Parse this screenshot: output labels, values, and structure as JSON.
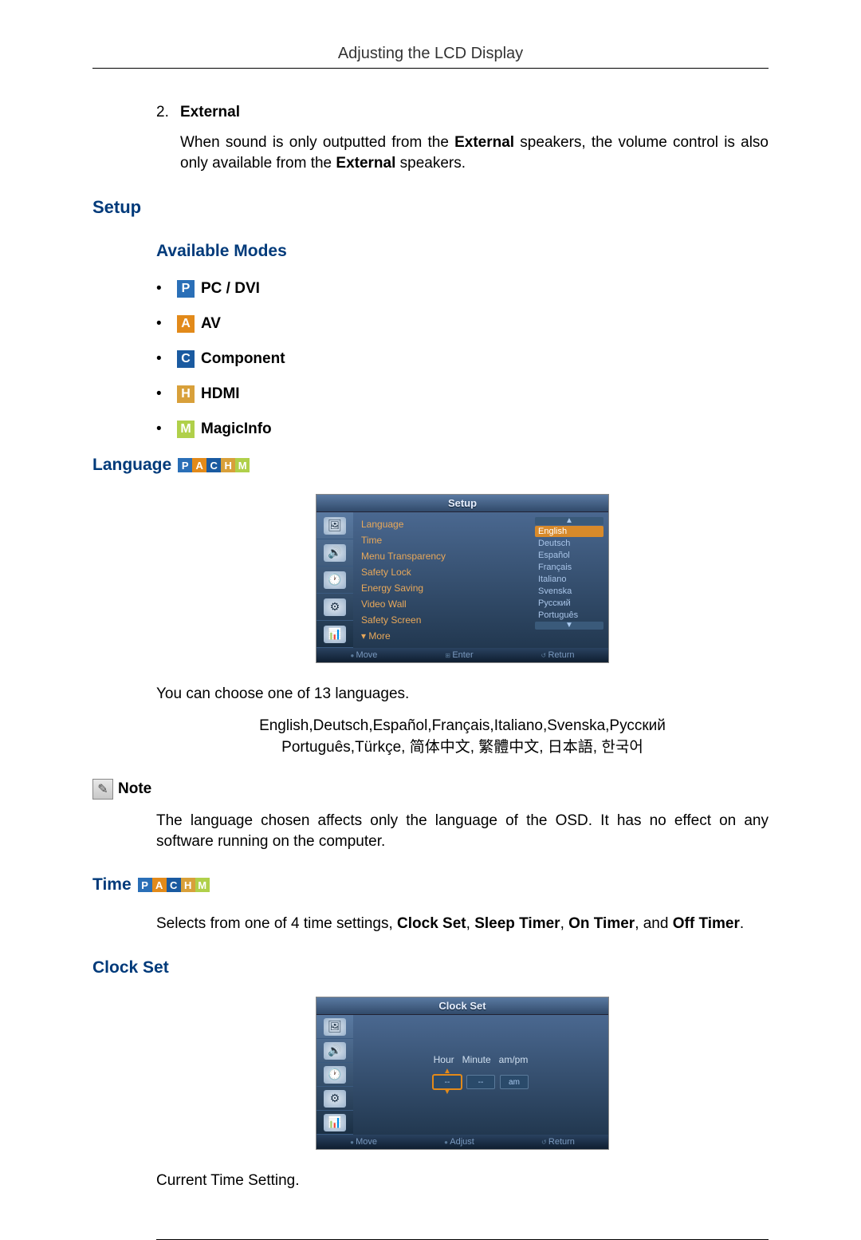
{
  "header": {
    "title": "Adjusting the LCD Display"
  },
  "external": {
    "number": "2.",
    "label": "External",
    "text_before": "When sound is only outputted from the ",
    "bold1": "External",
    "text_mid": " speakers, the volume control is also only available from the ",
    "bold2": "External",
    "text_after": " speakers."
  },
  "setup": {
    "heading": "Setup",
    "modes_heading": "Available Modes",
    "modes": [
      {
        "letter": "P",
        "cls": "badge-P",
        "label": "PC / DVI"
      },
      {
        "letter": "A",
        "cls": "badge-A",
        "label": "AV"
      },
      {
        "letter": "C",
        "cls": "badge-C",
        "label": "Component"
      },
      {
        "letter": "H",
        "cls": "badge-H",
        "label": "HDMI"
      },
      {
        "letter": "M",
        "cls": "badge-M",
        "label": "MagicInfo"
      }
    ]
  },
  "language": {
    "heading": "Language",
    "osd_title": "Setup",
    "menu_items": [
      "Language",
      "Time",
      "Menu Transparency",
      "Safety Lock",
      "Energy Saving",
      "Video Wall",
      "Safety Screen"
    ],
    "more": "▾ More",
    "options": [
      "English",
      "Deutsch",
      "Español",
      "Français",
      "Italiano",
      "Svenska",
      "Русский",
      "Português"
    ],
    "footer": {
      "move": "Move",
      "enter": "Enter",
      "return": "Return"
    },
    "caption": "You can choose one of 13 languages.",
    "langs_line1": "English,Deutsch,Español,Français,Italiano,Svenska,Русский",
    "langs_line2": "Português,Türkçe, 简体中文,  繁體中文, 日本語, 한국어",
    "note_label": "Note",
    "note_text": "The language chosen affects only the language of the OSD. It has no effect on any software running on the computer."
  },
  "time": {
    "heading": "Time",
    "text_before": "Selects from one of 4 time settings, ",
    "b1": "Clock Set",
    "sep": ", ",
    "b2": "Sleep Timer",
    "b3": "On Timer",
    "sep2": ", and ",
    "b4": "Off Timer",
    "end": "."
  },
  "clockset": {
    "heading": "Clock Set",
    "osd_title": "Clock Set",
    "labels": {
      "hour": "Hour",
      "minute": "Minute",
      "ampm": "am/pm"
    },
    "fields": {
      "hour": "--",
      "minute": "--",
      "ampm": "am"
    },
    "footer": {
      "move": "Move",
      "adjust": "Adjust",
      "return": "Return"
    },
    "caption": "Current Time Setting."
  },
  "mini_badges": [
    {
      "l": "P",
      "c": "badge-P"
    },
    {
      "l": "A",
      "c": "badge-A"
    },
    {
      "l": "C",
      "c": "badge-C"
    },
    {
      "l": "H",
      "c": "badge-H"
    },
    {
      "l": "M",
      "c": "badge-M"
    }
  ]
}
